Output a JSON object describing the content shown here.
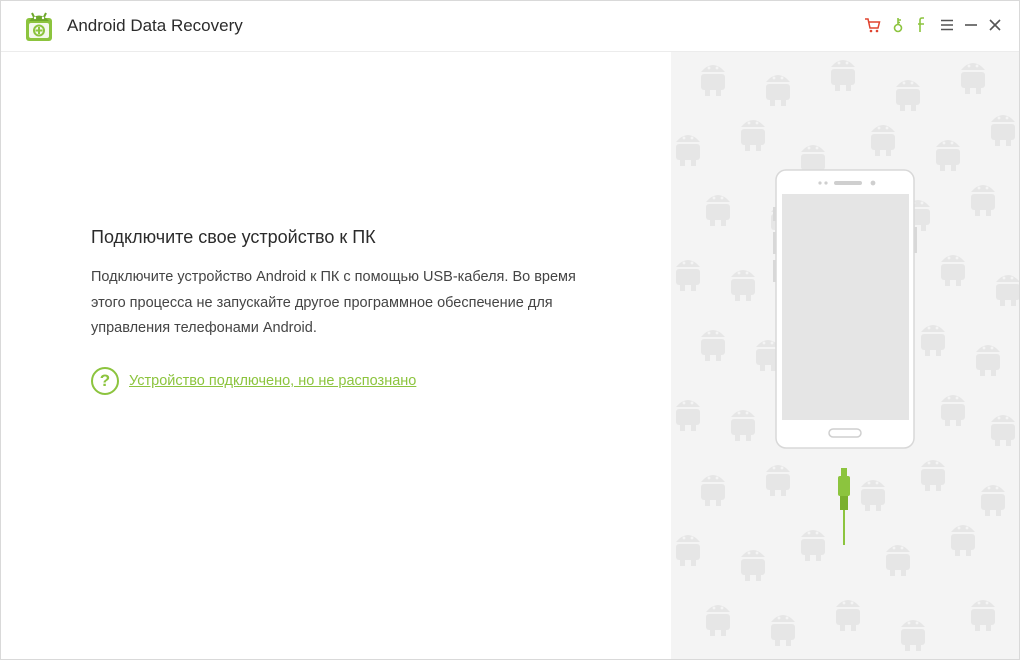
{
  "app": {
    "title": "Android Data Recovery",
    "accent_color": "#8cc43e",
    "cart_color": "#e0432f"
  },
  "titlebar": {
    "icons": [
      "cart-icon",
      "key-icon",
      "facebook-icon",
      "menu-icon",
      "minimize-icon",
      "close-icon"
    ]
  },
  "main": {
    "heading": "Подключите свое устройство к ПК",
    "description_lines": [
      "Подключите устройство Android к ПК с помощью USB-кабеля. Во время",
      "этого процесса не запускайте другое программное обеспечение для",
      "управления телефонами Android."
    ],
    "help_link": "Устройство подключено, но не распознано"
  }
}
